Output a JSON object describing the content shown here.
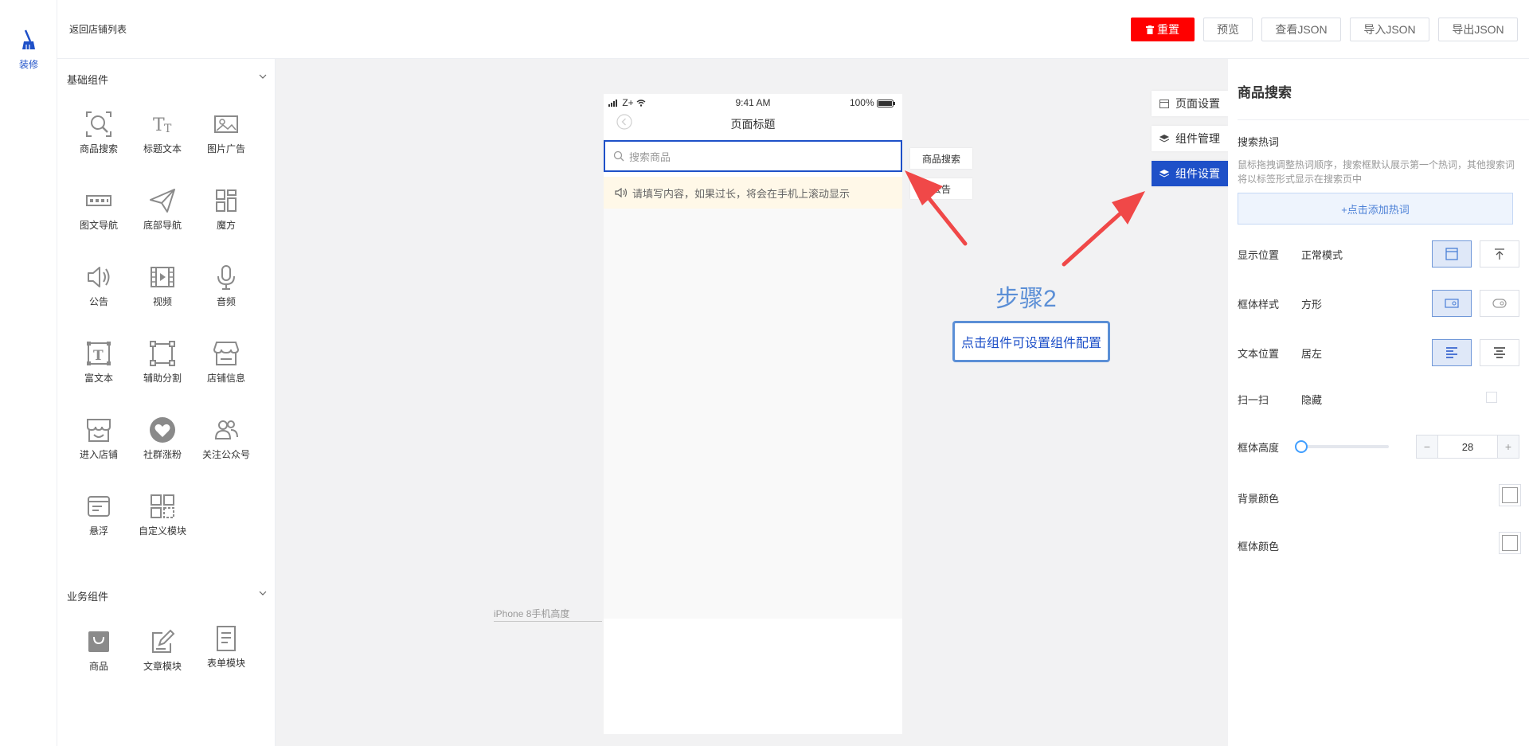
{
  "rail": {
    "label": "装修"
  },
  "topbar": {
    "back_label": "返回店铺列表",
    "buttons": {
      "reset": "重置",
      "preview": "预览",
      "view_json": "查看JSON",
      "import_json": "导入JSON",
      "export_json": "导出JSON"
    }
  },
  "components": {
    "basic_title": "基础组件",
    "basic": [
      "商品搜索",
      "标题文本",
      "图片广告",
      "图文导航",
      "底部导航",
      "魔方",
      "公告",
      "视频",
      "音频",
      "富文本",
      "辅助分割",
      "店铺信息",
      "进入店铺",
      "社群涨粉",
      "关注公众号",
      "悬浮",
      "自定义模块"
    ],
    "business_title": "业务组件",
    "business": [
      "商品",
      "文章模块",
      "表单模块"
    ]
  },
  "phone": {
    "status_time": "9:41 AM",
    "status_carrier": "Z+",
    "status_battery": "100%",
    "page_title": "页面标题",
    "search_placeholder": "搜索商品",
    "notice_text": "请填写内容，如果过长，将会在手机上滚动显示",
    "height_label": "iPhone 8手机高度"
  },
  "component_tags": {
    "search": "商品搜索",
    "notice": "公告"
  },
  "float_tabs": {
    "page_settings": "页面设置",
    "component_manage": "组件管理",
    "component_settings": "组件设置"
  },
  "guide": {
    "step": "步骤2",
    "tip": "点击组件可设置组件配置"
  },
  "settings": {
    "title": "商品搜索",
    "hot_label": "搜索热词",
    "hot_hint": "鼠标拖拽调整热词顺序，搜索框默认展示第一个热词，其他搜索词将以标签形式显示在搜索页中",
    "add_hot": "+点击添加热词",
    "position_label": "显示位置",
    "position_value": "正常模式",
    "frame_label": "框体样式",
    "frame_value": "方形",
    "text_label": "文本位置",
    "text_value": "居左",
    "scan_label": "扫一扫",
    "scan_value": "隐藏",
    "height_label": "框体高度",
    "height_value": "28",
    "bg_label": "背景颜色",
    "frame_color_label": "框体颜色"
  },
  "colors": {
    "accent": "#1e50c8",
    "reset": "#ff0000",
    "arrow": "#f04848",
    "guide": "#5b8fd6"
  }
}
